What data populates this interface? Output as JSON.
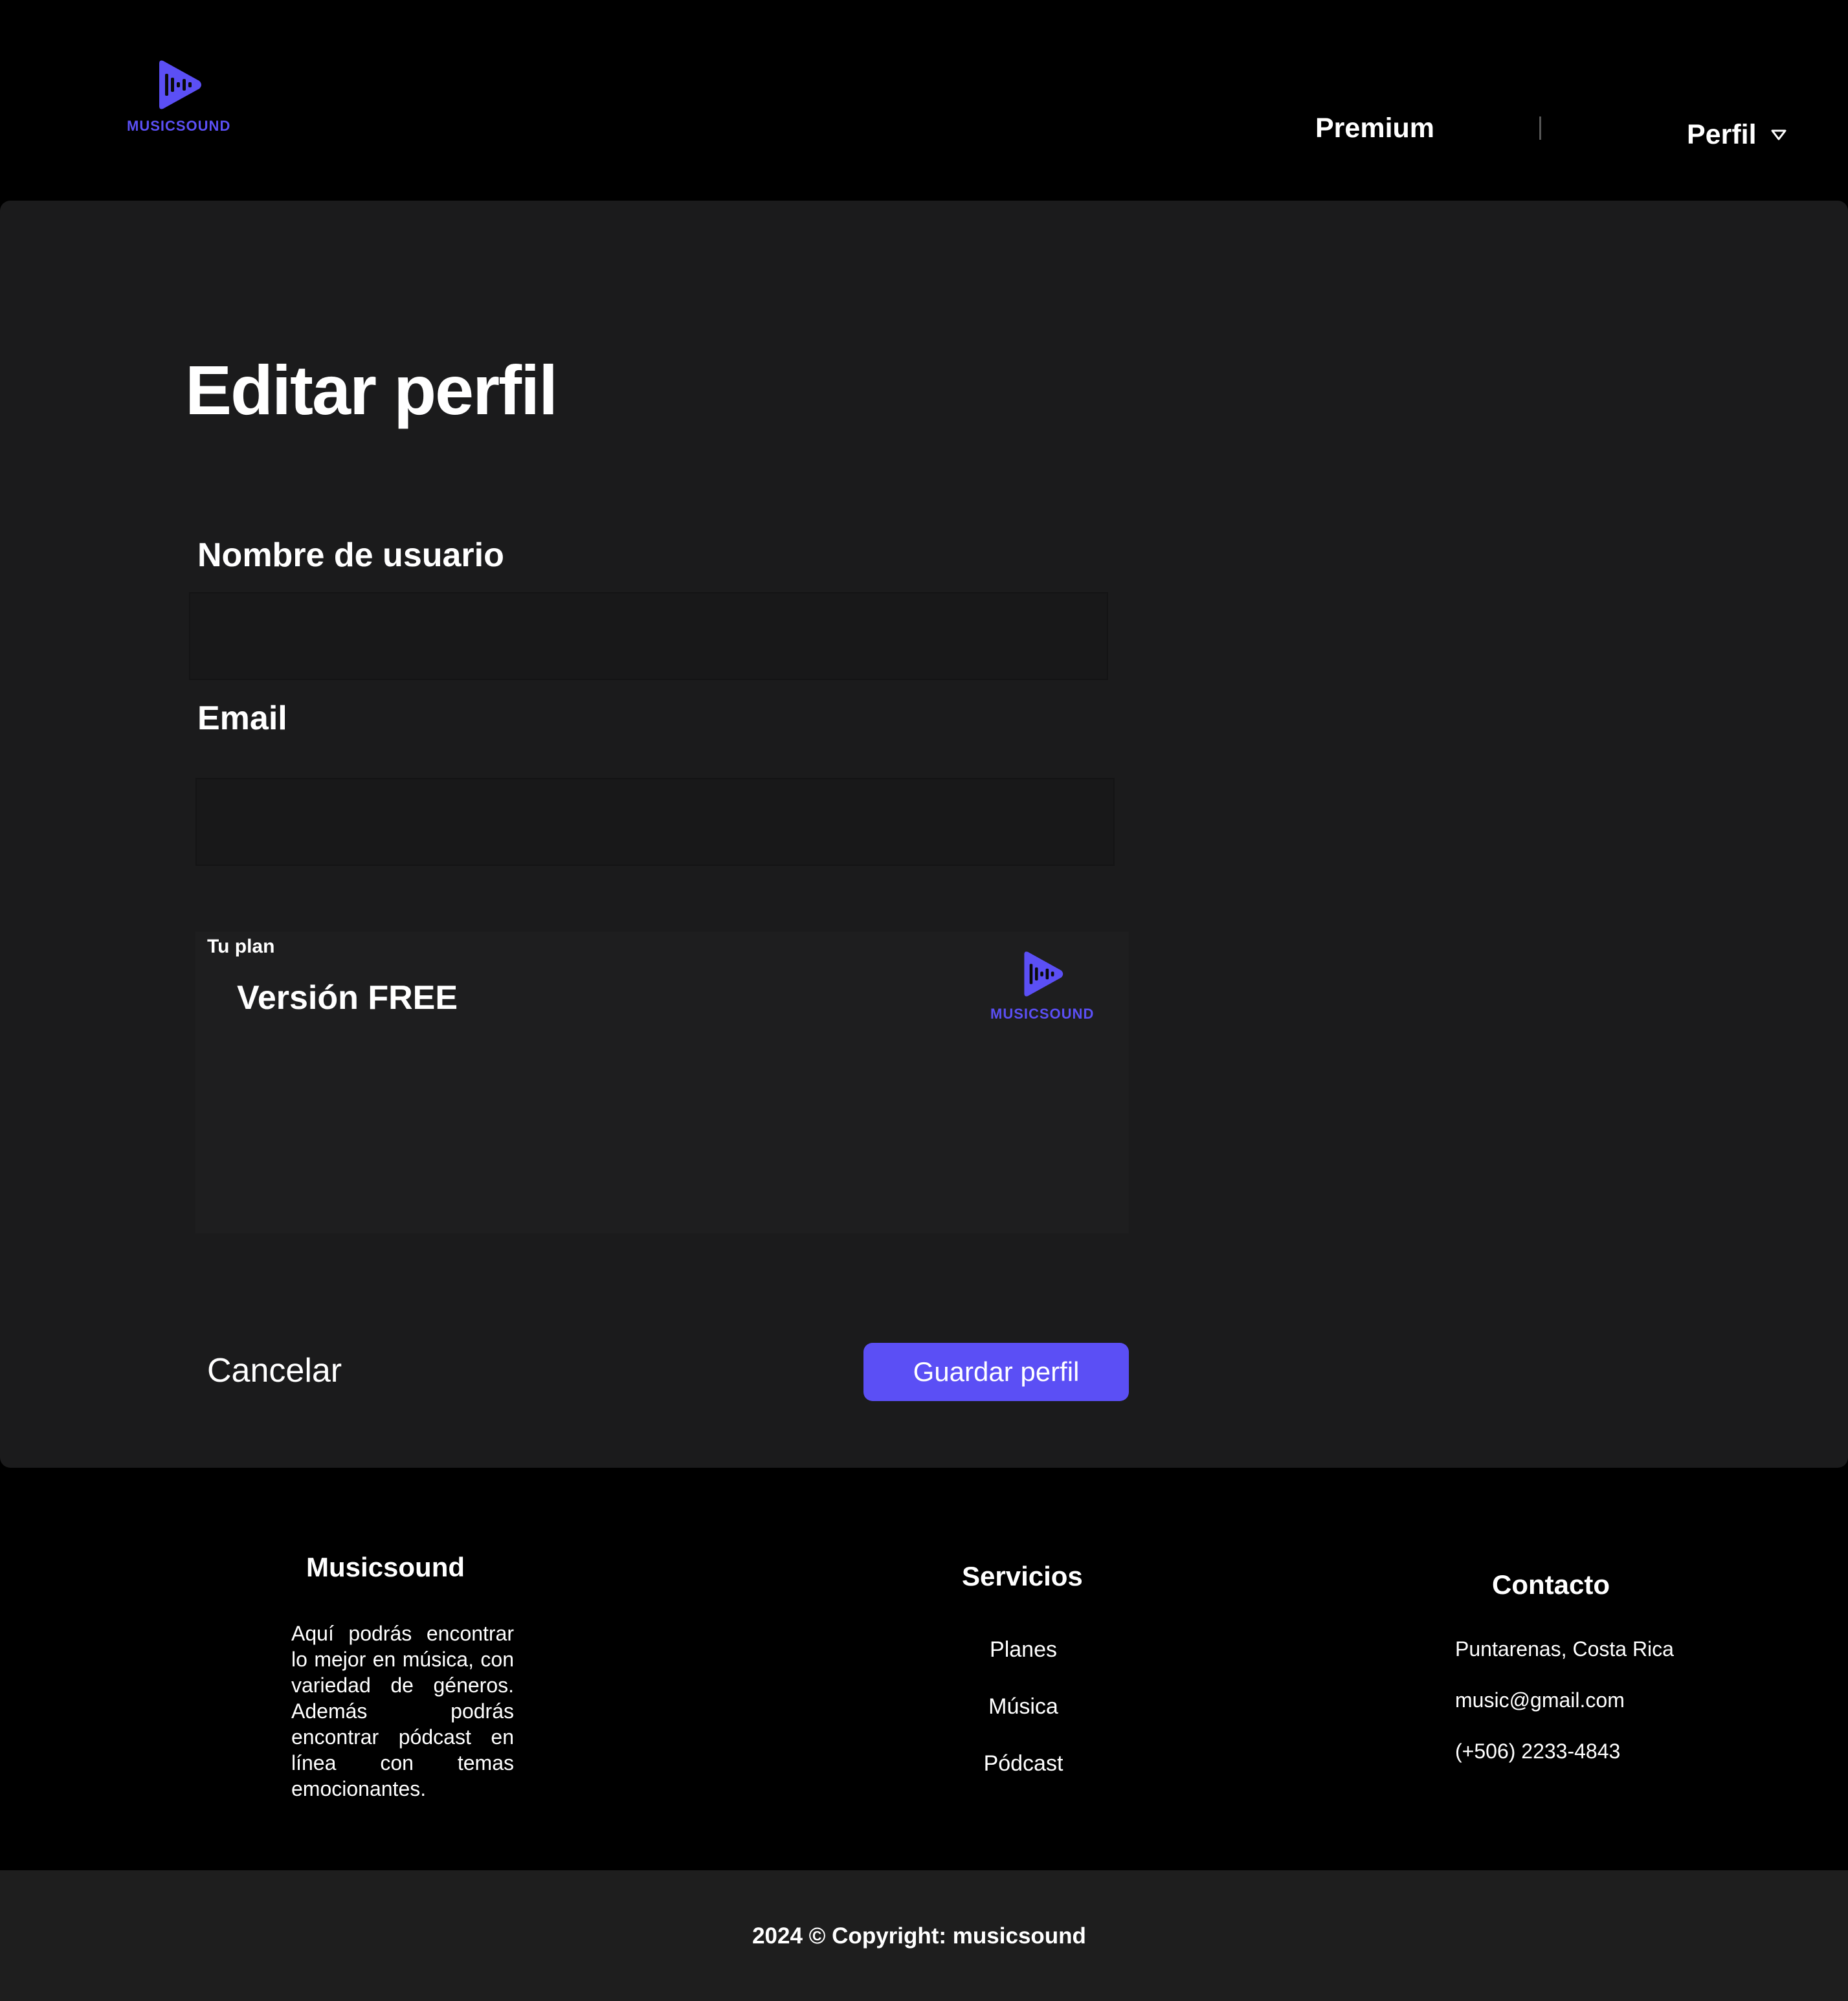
{
  "header": {
    "logo_text": "MUSICSOUND",
    "nav_premium": "Premium",
    "nav_profile": "Perfil"
  },
  "main": {
    "title": "Editar perfil",
    "username_label": "Nombre de usuario",
    "username_value": "",
    "email_label": "Email",
    "email_value": "",
    "plan": {
      "label": "Tu plan",
      "name": "Versión FREE",
      "logo_text": "MUSICSOUND"
    },
    "cancel_label": "Cancelar",
    "save_label": "Guardar perfil"
  },
  "footer": {
    "brand_heading": "Musicsound",
    "brand_description": "Aquí podrás encontrar lo mejor en música, con variedad de géneros. Además podrás encontrar pódcast en línea con temas emocionantes.",
    "services_heading": "Servicios",
    "services": [
      "Planes",
      "Música",
      "Pódcast"
    ],
    "contact_heading": "Contacto",
    "contact": [
      "Puntarenas, Costa Rica",
      "music@gmail.com",
      "(+506) 2233-4843"
    ],
    "copyright": "2024 © Copyright: musicsound"
  },
  "colors": {
    "accent": "#5b4ff5",
    "background": "#000000",
    "card": "#1b1b1c"
  }
}
